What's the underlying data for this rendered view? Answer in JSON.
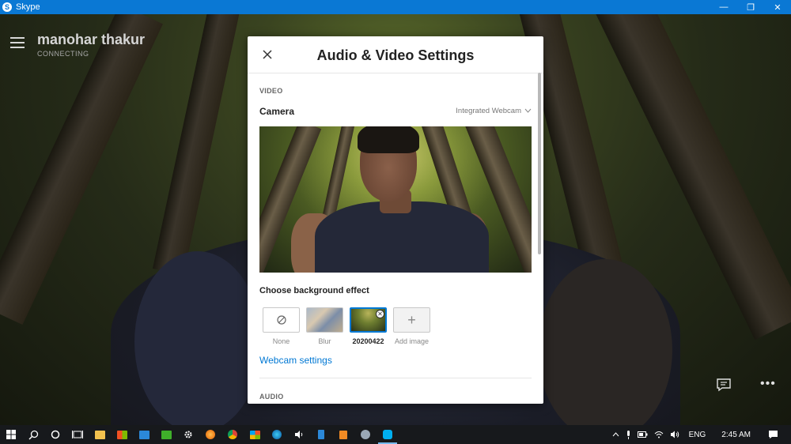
{
  "window": {
    "app_title": "Skype",
    "app_icon_letter": "S",
    "minimize_glyph": "—",
    "restore_glyph": "❐",
    "close_glyph": "✕"
  },
  "call": {
    "contact_name": "manohar thakur",
    "status": "CONNECTING",
    "more_glyph": "•••"
  },
  "dialog": {
    "title": "Audio & Video Settings",
    "video_section": "VIDEO",
    "camera_label": "Camera",
    "camera_value": "Integrated Webcam",
    "background_label": "Choose background effect",
    "effects": [
      {
        "label": "None",
        "icon": "none-icon"
      },
      {
        "label": "Blur",
        "icon": "blur-thumbnail"
      },
      {
        "label": "20200422",
        "icon": "image-thumbnail",
        "selected": true
      },
      {
        "label": "Add image",
        "icon": "plus-icon"
      }
    ],
    "add_glyph": "+",
    "remove_glyph": "✕",
    "webcam_settings_link": "Webcam settings",
    "audio_section": "AUDIO"
  },
  "taskbar": {
    "tray": {
      "language": "ENG",
      "time": "2:45 AM"
    }
  },
  "colors": {
    "accent": "#0078d4",
    "titlebar": "#0a78d4",
    "taskbar": "#17191c"
  }
}
